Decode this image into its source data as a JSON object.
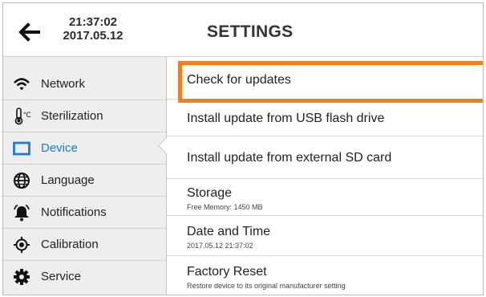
{
  "header": {
    "time": "21:37:02",
    "date": "2017.05.12",
    "title": "SETTINGS",
    "back_icon": "arrow-left-icon"
  },
  "sidebar": {
    "active": "Device",
    "items": [
      {
        "label": "Network",
        "icon": "wifi-icon"
      },
      {
        "label": "Sterilization",
        "icon": "thermometer-icon"
      },
      {
        "label": "Device",
        "icon": "device-icon"
      },
      {
        "label": "Language",
        "icon": "globe-icon"
      },
      {
        "label": "Notifications",
        "icon": "bell-icon"
      },
      {
        "label": "Calibration",
        "icon": "calibration-icon"
      },
      {
        "label": "Service",
        "icon": "gear-icon"
      }
    ]
  },
  "content": {
    "items": [
      {
        "title": "Check for updates"
      },
      {
        "title": "Install update from USB flash drive"
      },
      {
        "title": "Install update from external SD card"
      },
      {
        "title": "Storage",
        "subtitle": "Free Memory: 1450 MB"
      },
      {
        "title": "Date and Time",
        "subtitle": "2017.05.12 21:37:02"
      },
      {
        "title": "Factory Reset",
        "subtitle": "Restore device to its original manufacturer setting"
      }
    ]
  },
  "colors": {
    "accent": "#1f7ad6",
    "highlight": "#f07f1f",
    "sidebar_bg": "#eeeeee"
  }
}
